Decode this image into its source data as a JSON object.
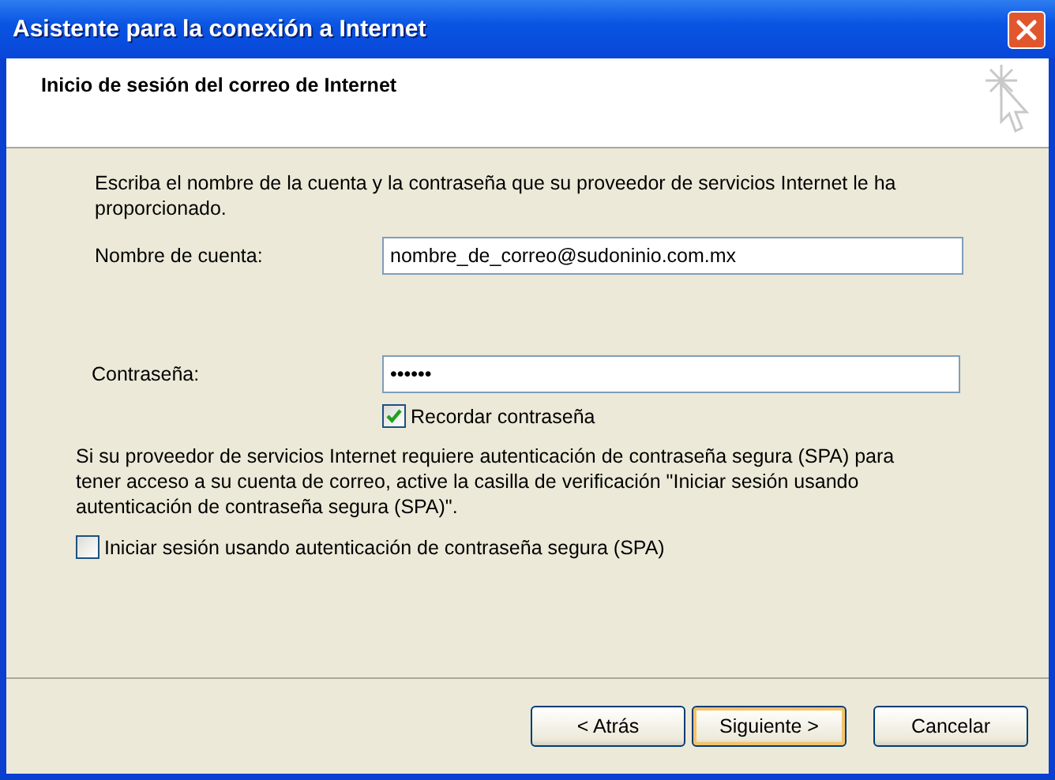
{
  "window": {
    "title": "Asistente para la conexión a Internet"
  },
  "header": {
    "title": "Inicio de sesión del correo de Internet"
  },
  "intro": "Escriba el nombre de la cuenta y la contraseña que su proveedor de servicios Internet le ha proporcionado.",
  "account": {
    "label": "Nombre de cuenta:",
    "value": "nombre_de_correo@sudoninio.com.mx"
  },
  "password": {
    "label": "Contraseña:",
    "value": "••••••"
  },
  "remember": {
    "label": "Recordar contraseña",
    "checked": true
  },
  "spa_note": "Si su proveedor de servicios Internet requiere autenticación de contraseña segura (SPA) para tener acceso a su cuenta de correo, active la casilla de verificación \"Iniciar sesión usando autenticación de contraseña segura (SPA)\".",
  "spa": {
    "label": "Iniciar sesión usando autenticación de contraseña segura (SPA)",
    "checked": false
  },
  "buttons": [
    {
      "label": "< Atrás",
      "default": false
    },
    {
      "label": "Siguiente >",
      "default": true
    },
    {
      "label": "Cancelar",
      "default": false
    }
  ]
}
